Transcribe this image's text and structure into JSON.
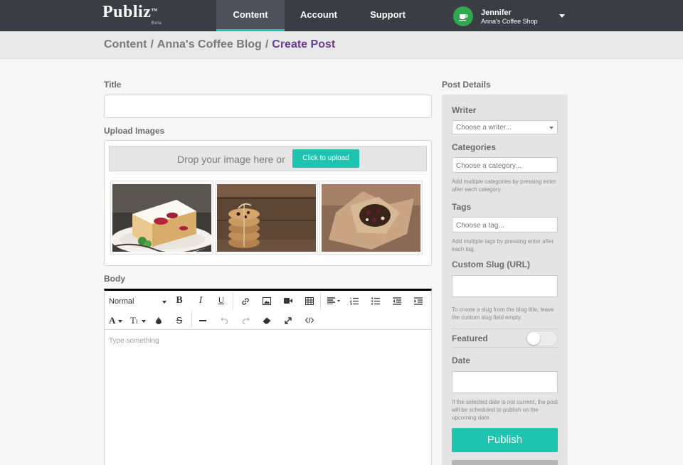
{
  "brand": {
    "name": "Publiz",
    "tm": "™",
    "badge": "Beta"
  },
  "nav": {
    "tabs": [
      "Content",
      "Account",
      "Support"
    ]
  },
  "user": {
    "name": "Jennifer",
    "shop": "Anna's Coffee Shop"
  },
  "breadcrumb": {
    "items": [
      "Content",
      "Anna's Coffee Blog"
    ],
    "separator": "/",
    "current": "Create Post"
  },
  "form": {
    "title_label": "Title",
    "upload_label": "Upload Images",
    "drop_text": "Drop your image here or",
    "upload_button": "Click to upload",
    "body_label": "Body",
    "body_placeholder": "Type something"
  },
  "toolbar": {
    "format_select": "Normal",
    "bold": "B",
    "italic": "I",
    "underline": "U",
    "strike": "S",
    "font_color": "A",
    "font_size": "T",
    "font_size_sup": "I"
  },
  "details": {
    "heading": "Post Details",
    "writer_label": "Writer",
    "writer_placeholder": "Choose a writer...",
    "categories_label": "Categories",
    "categories_placeholder": "Choose a category...",
    "categories_help": "Add multiple categories by pressing enter after each category.",
    "tags_label": "Tags",
    "tags_placeholder": "Choose a tag...",
    "tags_help": "Add multiple tags by pressing enter after each tag.",
    "slug_label": "Custom Slug (URL)",
    "slug_help": "To create a slug from the blog title, leave the custom slug field empty.",
    "featured_label": "Featured",
    "featured_on": false,
    "date_label": "Date",
    "date_help": "If the selected date is not current, the post will be scheduled to publish on the upcoming date.",
    "publish_button": "Publish"
  },
  "colors": {
    "accent": "#1fc4b0",
    "nav_bg": "#3b3d44",
    "crumb_current": "#6a3d8f",
    "avatar": "#2fa94f"
  }
}
